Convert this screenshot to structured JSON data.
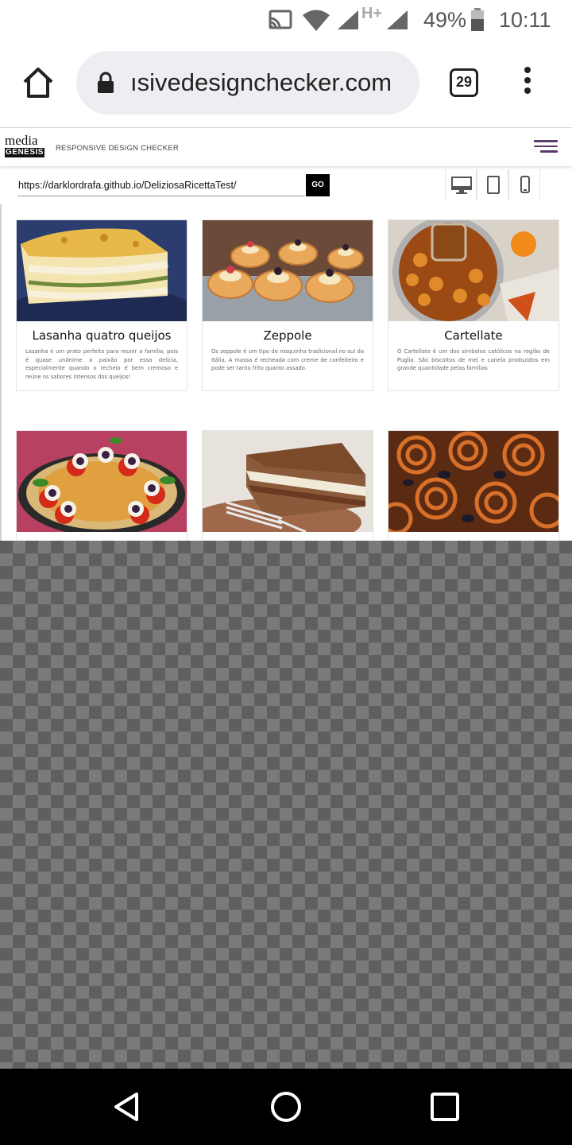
{
  "status_bar": {
    "battery_percent": "49%",
    "time": "10:11",
    "network_type": "H+",
    "icons": [
      "cast-icon",
      "wifi-icon",
      "signal-icon",
      "signal-h-plus-icon",
      "battery-icon"
    ]
  },
  "browser": {
    "url_display": "ısivedesigncheck​er.com",
    "tab_count": "29"
  },
  "site": {
    "logo_line1": "media",
    "logo_line2": "GENESIS",
    "title": "RESPONSIVE DESIGN CHECKER",
    "test_url": "https://darklordrafa.github.io/DeliziosaRicettaTest/",
    "go_label": "GO",
    "device_buttons": [
      "desktop-icon",
      "tablet-icon",
      "phone-icon"
    ]
  },
  "recipes": [
    {
      "title": "Lasanha quatro queijos",
      "description": "Lasanha é um prato perfeito para reunir a família, pois é quase unânime a paixão por essa delícia, especialmente quando o recheio é bem cremoso e reúne os sabores intensos dos queijos!"
    },
    {
      "title": "Zeppole",
      "description": "Os zeppole é um tipo de rosquinha tradicional no sul da Itália. A massa é recheada com creme de confeiteiro e pode ser tanto frito quanto assado."
    },
    {
      "title": "Cartellate",
      "description": "O Cartellate é um dos símbolos católicos na região de Puglia. São biscoitos de mel e canela produzidos em grande quantidade pelas famílias"
    },
    {
      "title": "",
      "description": ""
    },
    {
      "title": "",
      "description": ""
    },
    {
      "title": "",
      "description": ""
    }
  ],
  "colors": {
    "omnibox_bg": "#eceef1",
    "hamburger": "#5a3b6b",
    "navbar": "#000000"
  }
}
